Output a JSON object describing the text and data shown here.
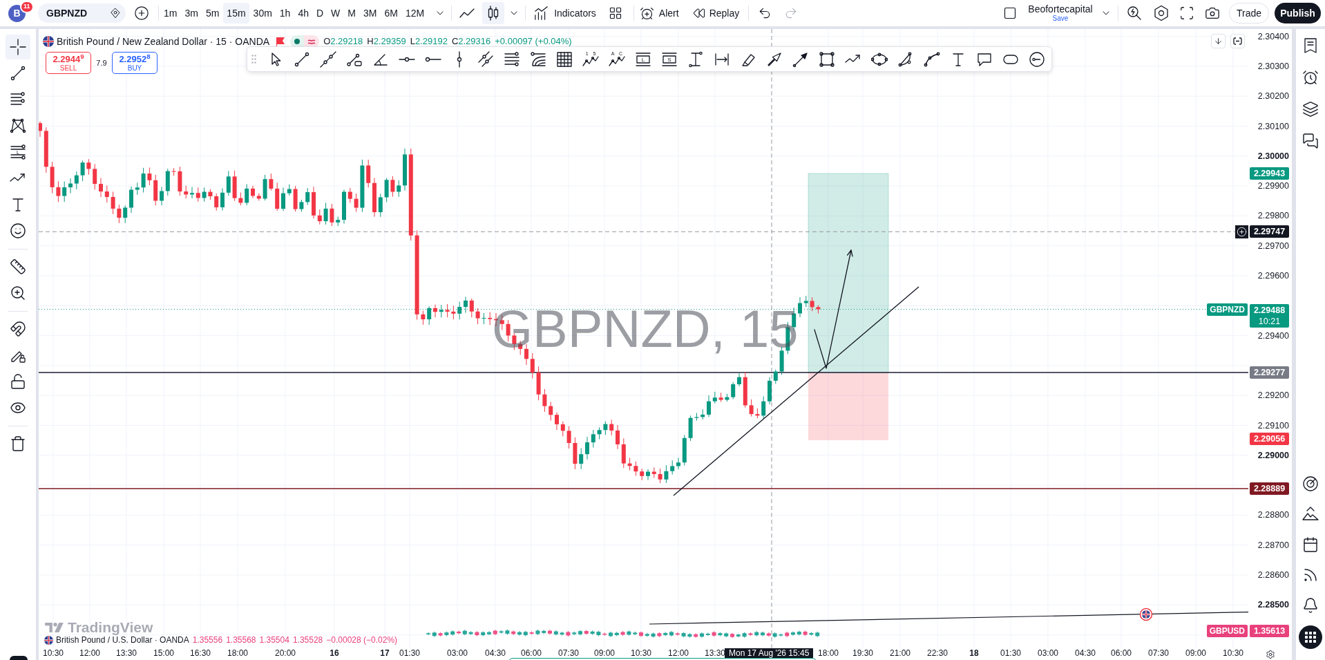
{
  "top_bar": {
    "avatar": {
      "initial": "B",
      "badge": "11"
    },
    "symbol": "GBPNZD",
    "intervals": [
      {
        "label": "1m",
        "selected": false
      },
      {
        "label": "3m",
        "selected": false
      },
      {
        "label": "5m",
        "selected": false
      },
      {
        "label": "15m",
        "selected": true
      },
      {
        "label": "30m",
        "selected": false
      },
      {
        "label": "1h",
        "selected": false
      },
      {
        "label": "4h",
        "selected": false
      },
      {
        "label": "D",
        "selected": false
      },
      {
        "label": "W",
        "selected": false
      },
      {
        "label": "M",
        "selected": false
      },
      {
        "label": "3M",
        "selected": false
      },
      {
        "label": "6M",
        "selected": false
      },
      {
        "label": "12M",
        "selected": false
      }
    ],
    "chart_types": [
      {
        "kind": "line",
        "selected": false
      },
      {
        "kind": "candles",
        "selected": true
      }
    ],
    "indicators": "Indicators",
    "alert": "Alert",
    "replay": "Replay",
    "history": [
      {
        "kind": "undo",
        "disabled": false
      },
      {
        "kind": "redo",
        "disabled": true
      }
    ],
    "layout": {
      "name": "Beofortecapital",
      "status": "Save"
    },
    "trade": "Trade",
    "publish": "Publish"
  },
  "left_toolbar": {
    "groups": [
      [
        {
          "kind": "crosshair",
          "selected": true
        },
        {
          "kind": "trend_line",
          "selected": false
        },
        {
          "kind": "fib",
          "selected": false
        },
        {
          "kind": "pattern",
          "selected": false
        },
        {
          "kind": "forecast",
          "glyph": "L",
          "selected": false
        },
        {
          "kind": "path_arrow",
          "selected": false
        },
        {
          "kind": "text",
          "selected": false
        },
        {
          "kind": "emoji",
          "selected": false
        }
      ],
      [
        {
          "kind": "ruler",
          "selected": false
        },
        {
          "kind": "zoom_in",
          "selected": false
        }
      ],
      [
        {
          "kind": "magnet",
          "selected": false
        },
        {
          "kind": "drawing_lock",
          "selected": false
        },
        {
          "kind": "lock",
          "selected": false
        },
        {
          "kind": "eye",
          "selected": false
        }
      ],
      [
        {
          "kind": "trash",
          "selected": false
        }
      ]
    ]
  },
  "chart": {
    "legend": {
      "title": "British Pound / New Zealand Dollar · 15 · OANDA",
      "ohlc": [
        {
          "key": "O",
          "value": "2.29218"
        },
        {
          "key": "H",
          "value": "2.29359"
        },
        {
          "key": "L",
          "value": "2.29192"
        },
        {
          "key": "C",
          "value": "2.29316"
        }
      ],
      "change": "+0.00097 (+0.04%)"
    },
    "sell": {
      "price": "2.2944$^{9}$",
      "label": "SELL"
    },
    "spread": "7.9",
    "buy": {
      "price": "2.2952$^{8}$",
      "label": "BUY"
    },
    "drawing_tools": [
      {
        "kind": "cursor"
      },
      {
        "kind": "trend_line"
      },
      {
        "kind": "extended_line"
      },
      {
        "kind": "info_line"
      },
      {
        "kind": "trend_angle"
      },
      {
        "kind": "horizontal_line"
      },
      {
        "kind": "horizontal_ray"
      },
      {
        "kind": "vertical_line"
      },
      {
        "kind": "cross_line"
      },
      {
        "kind": "fib_retracement"
      },
      {
        "kind": "fib_channel"
      },
      {
        "kind": "gann_box"
      },
      {
        "kind": "elliott_wave",
        "glyph": "1 5"
      },
      {
        "kind": "abcd_pattern",
        "glyph": "A C"
      },
      {
        "kind": "long_position",
        "glyph": "L"
      },
      {
        "kind": "short_position",
        "glyph": "S"
      },
      {
        "kind": "price_range"
      },
      {
        "kind": "date_range"
      },
      {
        "kind": "highlighter"
      },
      {
        "kind": "arrow"
      },
      {
        "kind": "arrow_marker"
      },
      {
        "kind": "rectangle"
      },
      {
        "kind": "path"
      },
      {
        "kind": "ellipse"
      },
      {
        "kind": "curve"
      },
      {
        "kind": "arc"
      },
      {
        "kind": "text"
      },
      {
        "kind": "callout"
      },
      {
        "kind": "note"
      },
      {
        "kind": "circle_marker"
      }
    ],
    "watermark": "GBPNZD, 15",
    "logo": "TradingView",
    "compare_legend": {
      "title": "British Pound / U.S. Dollar · OANDA",
      "values": [
        "1.35556",
        "1.35568",
        "1.35504",
        "1.35528",
        "−0.00028 (−0.02%)"
      ]
    }
  },
  "price_axis": {
    "labels": [
      {
        "text": "2.30400",
        "emphasized": false
      },
      {
        "text": "2.30300",
        "emphasized": false
      },
      {
        "text": "2.30200",
        "emphasized": false
      },
      {
        "text": "2.30100",
        "emphasized": false
      },
      {
        "text": "2.30000",
        "emphasized": true
      },
      {
        "text": "2.29900",
        "emphasized": false
      },
      {
        "text": "2.29800",
        "emphasized": false
      },
      {
        "text": "2.29700",
        "emphasized": false
      },
      {
        "text": "2.29600",
        "emphasized": false
      },
      {
        "text": "2.29400",
        "emphasized": false
      },
      {
        "text": "2.29200",
        "emphasized": false
      },
      {
        "text": "2.29100",
        "emphasized": false
      },
      {
        "text": "2.29000",
        "emphasized": true
      },
      {
        "text": "2.28800",
        "emphasized": false
      },
      {
        "text": "2.28700",
        "emphasized": false
      },
      {
        "text": "2.28600",
        "emphasized": false
      },
      {
        "text": "2.28500",
        "emphasized": true
      }
    ],
    "tags": [
      {
        "kind": "price",
        "text": "2.29943",
        "color": "#089981"
      },
      {
        "kind": "crosshair",
        "text": "2.29747",
        "color": "#131722"
      },
      {
        "kind": "last",
        "symbol": "GBPNZD",
        "text": "2.29488",
        "countdown": "10:21",
        "color": "#089981"
      },
      {
        "kind": "price",
        "text": "2.29277",
        "color": "#787b86"
      },
      {
        "kind": "price",
        "text": "2.29056",
        "color": "#f23645"
      },
      {
        "kind": "price",
        "text": "2.28889",
        "color": "#801922"
      },
      {
        "kind": "compare",
        "symbol": "GBPUSD",
        "text": "1.35613",
        "color": "#e8417b"
      }
    ]
  },
  "time_axis": {
    "labels": [
      {
        "text": "10:30",
        "emphasized": false
      },
      {
        "text": "12:00",
        "emphasized": false
      },
      {
        "text": "13:30",
        "emphasized": false
      },
      {
        "text": "15:00",
        "emphasized": false
      },
      {
        "text": "16:30",
        "emphasized": false
      },
      {
        "text": "18:00",
        "emphasized": false
      },
      {
        "text": "20:00",
        "emphasized": false
      },
      {
        "text": "16",
        "emphasized": true
      },
      {
        "text": "17",
        "emphasized": true
      },
      {
        "text": "01:30",
        "emphasized": false
      },
      {
        "text": "03:00",
        "emphasized": false
      },
      {
        "text": "04:30",
        "emphasized": false
      },
      {
        "text": "06:00",
        "emphasized": false
      },
      {
        "text": "07:30",
        "emphasized": false
      },
      {
        "text": "09:00",
        "emphasized": false
      },
      {
        "text": "10:30",
        "emphasized": false
      },
      {
        "text": "12:00",
        "emphasized": false
      },
      {
        "text": "13:30",
        "emphasized": false
      },
      {
        "text": "18:00",
        "emphasized": false
      },
      {
        "text": "19:30",
        "emphasized": false
      },
      {
        "text": "21:00",
        "emphasized": false
      },
      {
        "text": "22:30",
        "emphasized": false
      },
      {
        "text": "18",
        "emphasized": true
      },
      {
        "text": "01:30",
        "emphasized": false
      },
      {
        "text": "03:00",
        "emphasized": false
      },
      {
        "text": "04:30",
        "emphasized": false
      },
      {
        "text": "06:00",
        "emphasized": false
      },
      {
        "text": "07:30",
        "emphasized": false
      },
      {
        "text": "09:00",
        "emphasized": false
      },
      {
        "text": "10:30",
        "emphasized": false
      }
    ],
    "crosshair_label": "Mon 17 Aug '26 15:45"
  }
}
